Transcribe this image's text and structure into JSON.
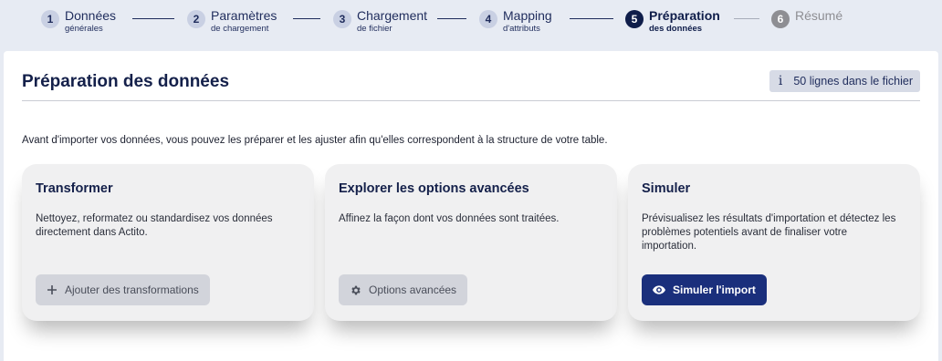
{
  "stepper": {
    "steps": [
      {
        "num": "1",
        "label": "Données",
        "sub": "générales"
      },
      {
        "num": "2",
        "label": "Paramètres",
        "sub": "de chargement"
      },
      {
        "num": "3",
        "label": "Chargement",
        "sub": "de fichier"
      },
      {
        "num": "4",
        "label": "Mapping",
        "sub": "d'attributs"
      },
      {
        "num": "5",
        "label": "Préparation",
        "sub": "des données"
      },
      {
        "num": "6",
        "label": "Résumé",
        "sub": ""
      }
    ],
    "active_step": 5
  },
  "page": {
    "title": "Préparation des données",
    "row_count_text": "50 lignes dans le fichier",
    "intro": "Avant d'importer vos données, vous pouvez les préparer et les ajuster afin qu'elles correspondent à la structure de votre table."
  },
  "cards": {
    "transform": {
      "title": "Transformer",
      "description": "Nettoyez, reformatez ou standardisez vos données directement dans Actito.",
      "button": "Ajouter des transformations",
      "icon": "plus-icon"
    },
    "advanced": {
      "title": "Explorer les options avancées",
      "description": "Affinez la façon dont vos données sont traitées.",
      "button": "Options avancées",
      "icon": "gear-icon"
    },
    "simulate": {
      "title": "Simuler",
      "description": "Prévisualisez les résultats d'importation et détectez les problèmes potentiels avant de finaliser votre importation.",
      "button": "Simuler l'import",
      "icon": "eye-icon"
    }
  },
  "colors": {
    "accent": "#1a2f7c",
    "active_step": "#0f1d4a",
    "background": "#e7ebf3"
  }
}
